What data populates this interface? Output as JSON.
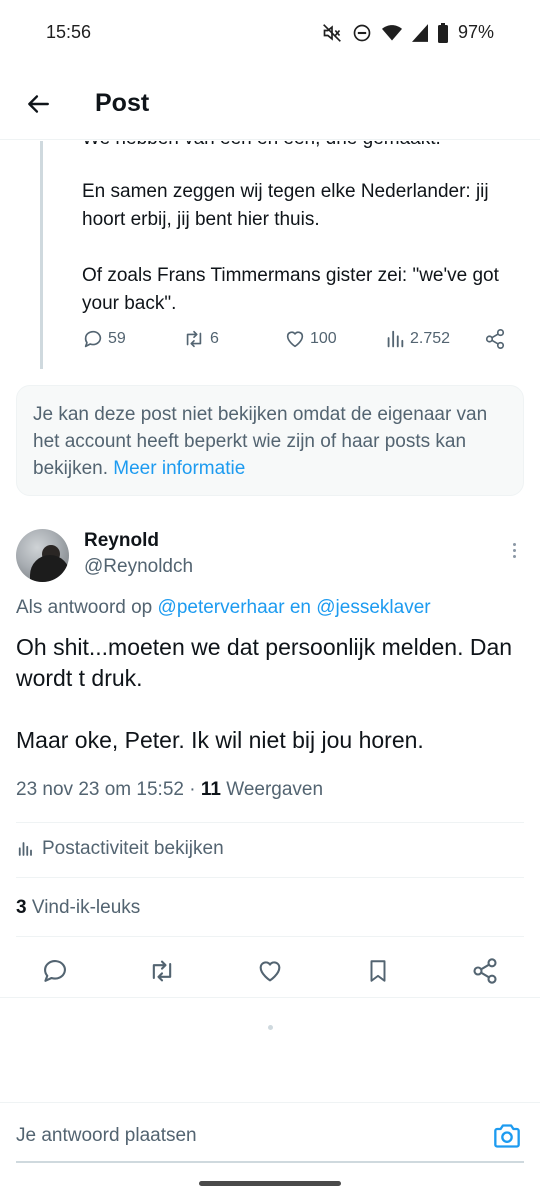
{
  "status_bar": {
    "time": "15:56",
    "battery": "97%",
    "icons": [
      "mute-icon",
      "dnd-icon",
      "wifi-icon",
      "signal-icon",
      "battery-icon"
    ]
  },
  "header": {
    "title": "Post",
    "back_icon": "arrow-left-icon"
  },
  "quoted_post": {
    "cut_line": "We hebben van een en een, drie gemaakt.",
    "paragraphs": [
      "En samen zeggen wij tegen elke Nederlander: jij hoort erbij, jij bent hier thuis.",
      "Of zoals Frans Timmermans gister zei: \"we've got your back\"."
    ],
    "actions": {
      "replies": "59",
      "reposts": "6",
      "likes": "100",
      "views": "2.752"
    }
  },
  "notice": {
    "text": "Je kan deze post niet bekijken omdat de eigenaar van het account heeft beperkt wie zijn of haar posts kan bekijken.",
    "link": "Meer informatie"
  },
  "reply_post": {
    "name": "Reynold",
    "handle": "@Reynoldch",
    "reply_prefix": "Als antwoord op",
    "reply_user_1": "@peterverhaar",
    "reply_and": "en",
    "reply_user_2": "@jesseklaver",
    "paragraphs": [
      "Oh shit...moeten we dat persoonlijk melden. Dan wordt t druk.",
      "Maar oke, Peter. Ik wil niet bij jou horen."
    ],
    "timestamp": "23 nov 23 om 15:52",
    "separator": "·",
    "views_count": "11",
    "views_label": "Weergaven",
    "activity_label": "Postactiviteit bekijken",
    "likes_count": "3",
    "likes_label": "Vind-ik-leuks"
  },
  "composer": {
    "placeholder": "Je antwoord plaatsen"
  },
  "colors": {
    "accent": "#1d9bf0",
    "text": "#0f1419",
    "secondary": "#536471",
    "border": "#eff3f4"
  }
}
